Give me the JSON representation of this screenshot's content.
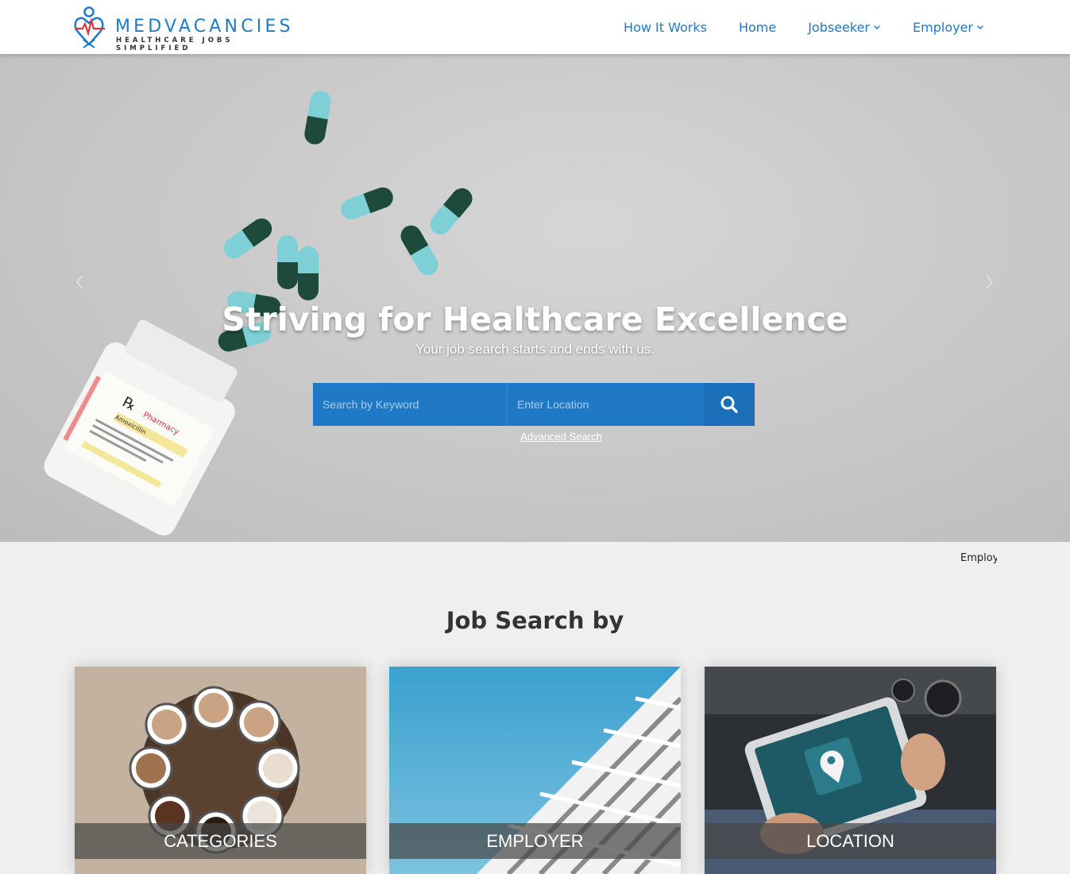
{
  "brand": {
    "name": "MEDVACANCIES",
    "tagline": "HEALTHCARE JOBS SIMPLIFIED"
  },
  "nav": {
    "items": [
      {
        "label": "How It Works",
        "dropdown": false
      },
      {
        "label": "Home",
        "dropdown": false
      },
      {
        "label": "Jobseeker",
        "dropdown": true
      },
      {
        "label": "Employer",
        "dropdown": true
      }
    ]
  },
  "hero": {
    "title": "Striving for Healthcare Excellence",
    "subtitle": "Your job search starts and ends with us.",
    "keyword_placeholder": "Search by Keyword",
    "location_placeholder": "Enter Location",
    "advanced_link": "Advanced Search",
    "label_rx": "Pharmacy",
    "label_drug": "Amoxicillin"
  },
  "ticker": {
    "text": "Employ"
  },
  "job_search": {
    "title": "Job Search by",
    "cards": [
      {
        "label": "CATEGORIES"
      },
      {
        "label": "EMPLOYER"
      },
      {
        "label": "LOCATION"
      }
    ]
  },
  "colors": {
    "primary": "#1f79c5",
    "search_button": "#1a6fb8",
    "page_bg": "#efefef"
  },
  "icons": [
    "logo-heart-icon",
    "chevron-down-icon",
    "chevron-left-icon",
    "chevron-right-icon",
    "search-icon"
  ]
}
